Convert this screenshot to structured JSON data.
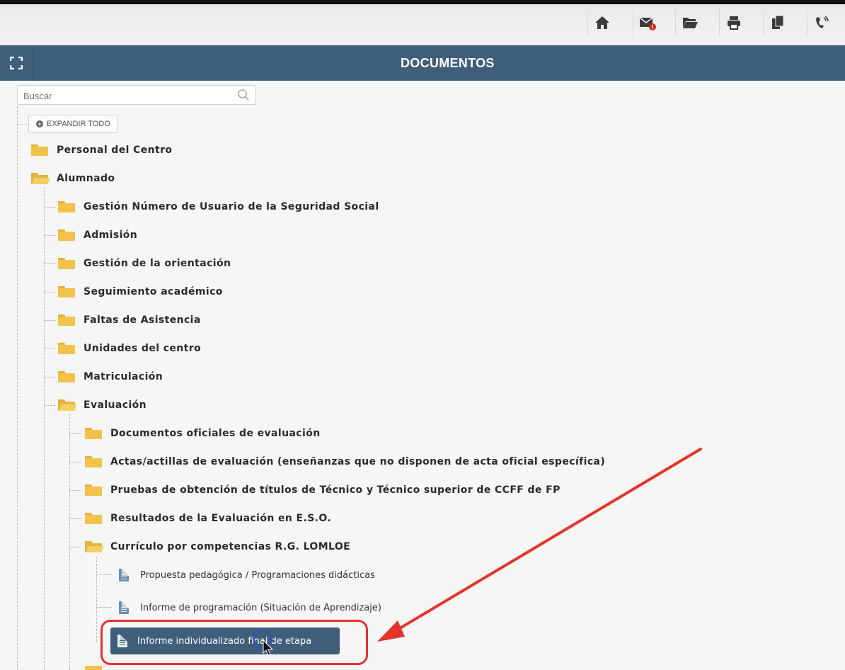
{
  "toolbar": {
    "icons": [
      "home-icon",
      "mail-alert-icon",
      "folder-open-icon",
      "print-icon",
      "copy-icon",
      "phone-icon"
    ]
  },
  "header": {
    "title": "DOCUMENTOS"
  },
  "search": {
    "placeholder": "Buscar"
  },
  "expand_all": {
    "label": "EXPANDIR TODO"
  },
  "tree": {
    "personal": "Personal del Centro",
    "alumnado": "Alumnado",
    "alumnado_children": {
      "gestion_nuss": "Gestión Número de Usuario de la Seguridad Social",
      "admision": "Admisión",
      "orientacion": "Gestión de la orientación",
      "seguimiento": "Seguimiento académico",
      "faltas": "Faltas de Asistencia",
      "unidades": "Unidades del centro",
      "matriculacion": "Matriculación",
      "evaluacion": "Evaluación"
    },
    "evaluacion_children": {
      "doc_oficiales": "Documentos oficiales de evaluación",
      "actas": "Actas/actillas de evaluación (enseñanzas que no disponen de acta oficial específica)",
      "pruebas": "Pruebas de obtención de títulos de Técnico y Técnico superior de CCFF de FP",
      "resultados": "Resultados de la Evaluación en E.S.O.",
      "curriculo": "Currículo por competencias R.G. LOMLOE"
    },
    "curriculo_children": {
      "propuesta": "Propuesta pedagógica / Programaciones didácticas",
      "informe_programacion": "Informe de programación (Situación de Aprendizaje)",
      "informe_individualizado": "Informe individualizado final de etapa"
    }
  },
  "colors": {
    "header_bg": "#3f5e79",
    "folder": "#f2c24a",
    "annotation": "#e3342a"
  }
}
